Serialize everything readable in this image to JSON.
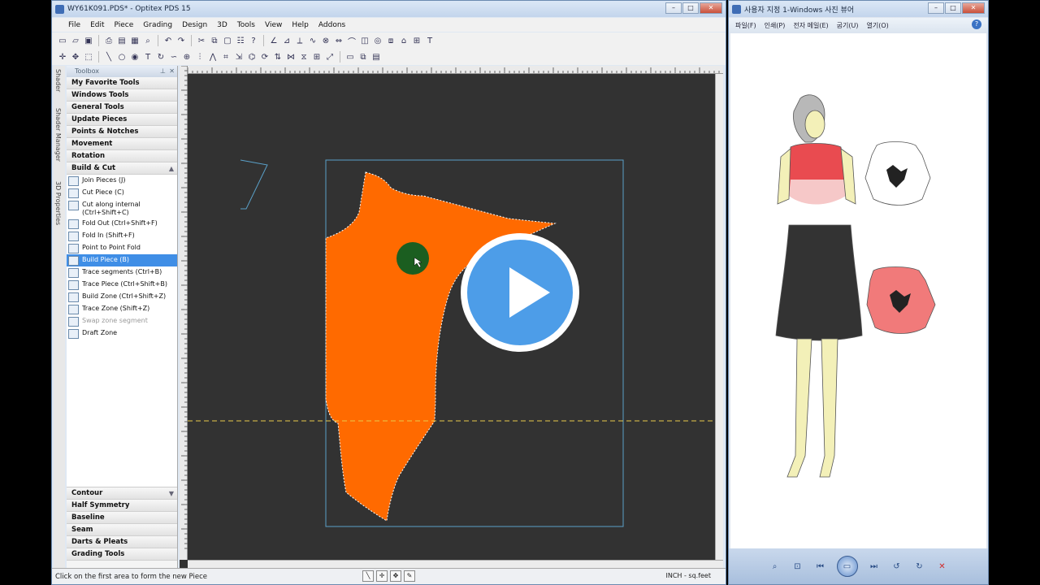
{
  "optitex": {
    "title": "WY61K091.PDS* - Optitex PDS 15",
    "menu": [
      "File",
      "Edit",
      "Piece",
      "Grading",
      "Design",
      "3D",
      "Tools",
      "View",
      "Help",
      "Addons"
    ],
    "side_tabs": [
      "Shader",
      "Shader Manager",
      "3D Properties"
    ],
    "toolbox": {
      "title": "Toolbox",
      "categories_top": [
        "My Favorite Tools",
        "Windows Tools",
        "General Tools",
        "Update Pieces",
        "Points & Notches",
        "Movement",
        "Rotation"
      ],
      "open_category": "Build & Cut",
      "tools": [
        {
          "label": "Join Pieces (J)",
          "state": "normal"
        },
        {
          "label": "Cut Piece (C)",
          "state": "normal"
        },
        {
          "label": "Cut along internal (Ctrl+Shift+C)",
          "state": "normal"
        },
        {
          "label": "Fold Out (Ctrl+Shift+F)",
          "state": "normal"
        },
        {
          "label": "Fold In (Shift+F)",
          "state": "normal"
        },
        {
          "label": "Point to Point Fold",
          "state": "normal"
        },
        {
          "label": "Build Piece (B)",
          "state": "selected"
        },
        {
          "label": "Trace segments (Ctrl+B)",
          "state": "normal"
        },
        {
          "label": "Trace Piece (Ctrl+Shift+B)",
          "state": "normal"
        },
        {
          "label": "Build Zone (Ctrl+Shift+Z)",
          "state": "normal"
        },
        {
          "label": "Trace Zone (Shift+Z)",
          "state": "normal"
        },
        {
          "label": "Swap zone segment",
          "state": "disabled"
        },
        {
          "label": "Draft Zone",
          "state": "normal"
        }
      ],
      "categories_bottom": [
        "Contour",
        "Half Symmetry",
        "Baseline",
        "Seam",
        "Darts & Pleats",
        "Grading Tools"
      ]
    },
    "status": {
      "message": "Click on the first area to form the new Piece",
      "units": "INCH - sq.feet"
    },
    "colors": {
      "canvas": "#323232",
      "piece_fill": "#ff6a00",
      "piece_outline": "#ffffff",
      "bounding_box": "#5aa0c8",
      "fold_line": "#e8c94a",
      "cursor_marker": "#1b5e20"
    }
  },
  "viewer": {
    "title": "사용자 지정 1-Windows 사진 뷰어",
    "menu": [
      "파일(F)",
      "인쇄(P)",
      "전자 메일(E)",
      "굽기(U)",
      "열기(O)"
    ],
    "help_icon": "help-icon",
    "controls": [
      "zoom-icon",
      "fit-icon",
      "prev-icon",
      "slideshow-icon",
      "next-icon",
      "rotate-left-icon",
      "rotate-right-icon",
      "delete-icon"
    ]
  },
  "overlay": {
    "icon": "play-icon",
    "color": "#4d9de8"
  }
}
